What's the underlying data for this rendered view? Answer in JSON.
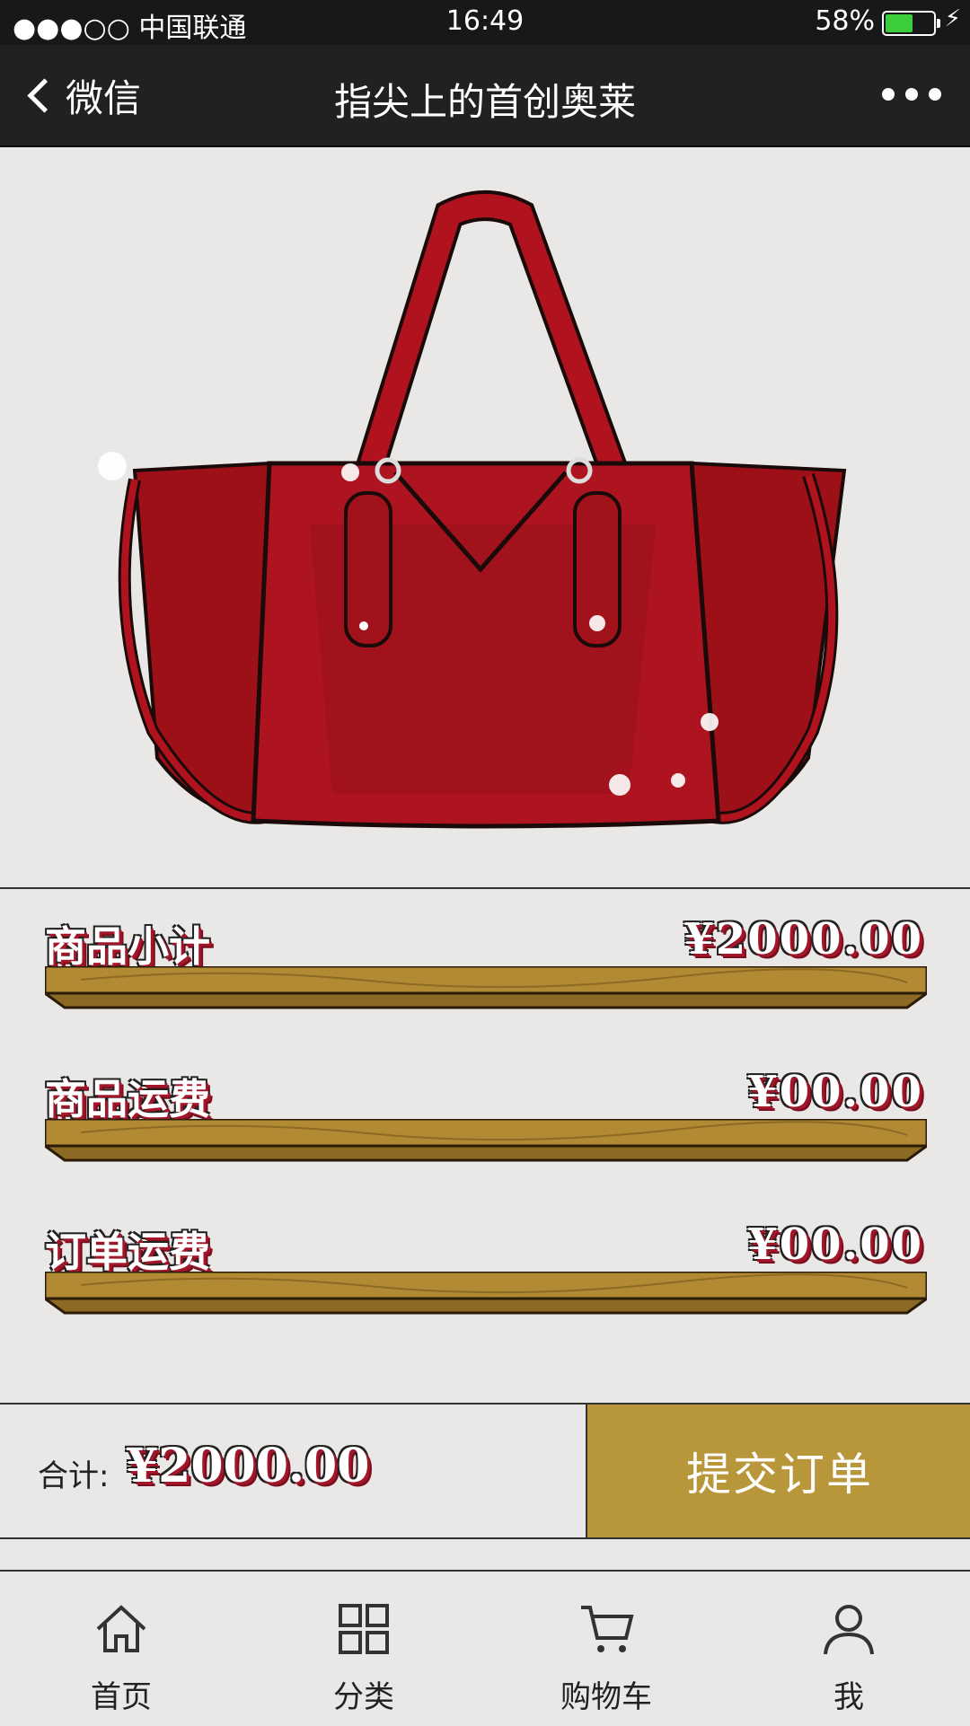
{
  "status_bar": {
    "carrier": "●●●○○ 中国联通",
    "time": "16:49",
    "battery": "58%",
    "battery_level": 0.58
  },
  "nav": {
    "back_label": "微信",
    "title": "指尖上的首创奥莱"
  },
  "summary": [
    {
      "label": "商品小计",
      "value": "¥2000.00"
    },
    {
      "label": "商品运费",
      "value": "¥00.00"
    },
    {
      "label": "订单运费",
      "value": "¥00.00"
    }
  ],
  "total": {
    "label": "合计:",
    "value": "¥2000.00"
  },
  "submit_label": "提交订单",
  "tabs": [
    {
      "label": "首页",
      "icon": "home-icon"
    },
    {
      "label": "分类",
      "icon": "grid-icon"
    },
    {
      "label": "购物车",
      "icon": "cart-icon"
    },
    {
      "label": "我",
      "icon": "user-icon"
    }
  ],
  "colors": {
    "accent": "#b8963a",
    "bag": "#b0131d",
    "navbar": "#202123"
  }
}
